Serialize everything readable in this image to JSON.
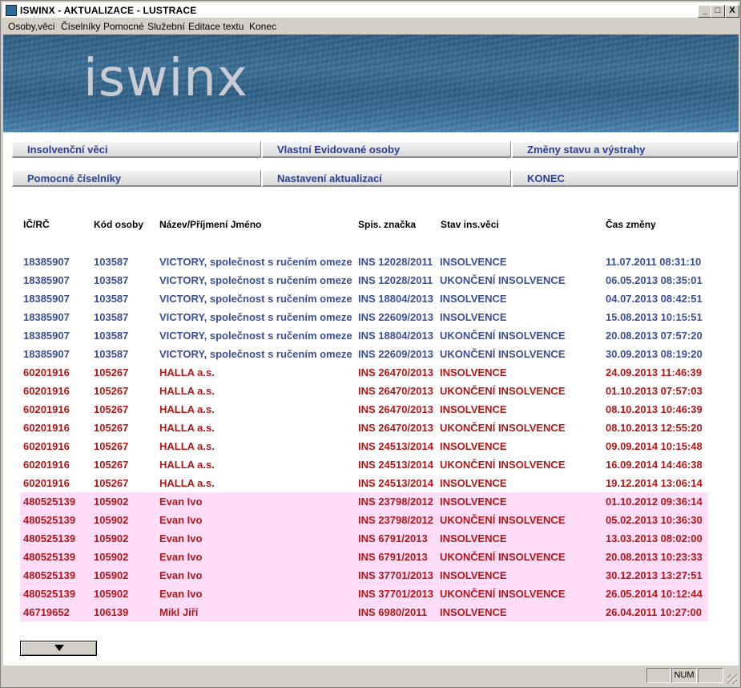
{
  "window": {
    "title": "ISWINX - AKTUALIZACE - LUSTRACE"
  },
  "window_buttons": {
    "minimize": "_",
    "maximize": "□",
    "close": "X"
  },
  "menu": [
    "Osoby,věci",
    "Číselníky",
    "Pomocné",
    "Služební",
    "Editace textu",
    "Konec"
  ],
  "banner": {
    "logo": "iswinx"
  },
  "nav": {
    "row1": [
      "Insolvenční věci",
      "Vlastní Evidované osoby",
      "Změny stavu a výstrahy"
    ],
    "row2": [
      "Pomocné číselníky",
      "Nastavení aktualizací",
      "KONEC"
    ]
  },
  "table": {
    "headers": [
      "IČ/RČ",
      "Kód osoby",
      "Název/Příjmení Jméno",
      "Spis. značka",
      "Stav ins.věci",
      "Čas změny"
    ],
    "rows": [
      {
        "ic": "18385907",
        "kod": "103587",
        "nazev": "VICTORY, společnost s ručením omezeným",
        "spis": "INS 12028/2011",
        "stav": "INSOLVENCE",
        "cas": "11.07.2011 08:31:10",
        "group": "blue"
      },
      {
        "ic": "18385907",
        "kod": "103587",
        "nazev": "VICTORY, společnost s ručením omezeným",
        "spis": "INS 12028/2011",
        "stav": "UKONČENÍ INSOLVENCE",
        "cas": "06.05.2013 08:35:01",
        "group": "blue"
      },
      {
        "ic": "18385907",
        "kod": "103587",
        "nazev": "VICTORY, společnost s ručením omezeným",
        "spis": "INS 18804/2013",
        "stav": "INSOLVENCE",
        "cas": "04.07.2013 08:42:51",
        "group": "blue"
      },
      {
        "ic": "18385907",
        "kod": "103587",
        "nazev": "VICTORY, společnost s ručením omezeným",
        "spis": "INS 22609/2013",
        "stav": "INSOLVENCE",
        "cas": "15.08.2013 10:15:51",
        "group": "blue"
      },
      {
        "ic": "18385907",
        "kod": "103587",
        "nazev": "VICTORY, společnost s ručením omezeným",
        "spis": "INS 18804/2013",
        "stav": "UKONČENÍ INSOLVENCE",
        "cas": "20.08.2013 07:57:20",
        "group": "blue"
      },
      {
        "ic": "18385907",
        "kod": "103587",
        "nazev": "VICTORY, společnost s ručením omezeným",
        "spis": "INS 22609/2013",
        "stav": "UKONČENÍ INSOLVENCE",
        "cas": "30.09.2013 08:19:20",
        "group": "blue"
      },
      {
        "ic": "60201916",
        "kod": "105267",
        "nazev": "HALLA a.s.",
        "spis": "INS 26470/2013",
        "stav": "INSOLVENCE",
        "cas": "24.09.2013 11:46:39",
        "group": "red"
      },
      {
        "ic": "60201916",
        "kod": "105267",
        "nazev": "HALLA a.s.",
        "spis": "INS 26470/2013",
        "stav": "UKONČENÍ INSOLVENCE",
        "cas": "01.10.2013 07:57:03",
        "group": "red"
      },
      {
        "ic": "60201916",
        "kod": "105267",
        "nazev": "HALLA a.s.",
        "spis": "INS 26470/2013",
        "stav": "INSOLVENCE",
        "cas": "08.10.2013 10:46:39",
        "group": "red"
      },
      {
        "ic": "60201916",
        "kod": "105267",
        "nazev": "HALLA a.s.",
        "spis": "INS 26470/2013",
        "stav": "UKONČENÍ INSOLVENCE",
        "cas": "08.10.2013 12:55:20",
        "group": "red"
      },
      {
        "ic": "60201916",
        "kod": "105267",
        "nazev": "HALLA a.s.",
        "spis": "INS 24513/2014",
        "stav": "INSOLVENCE",
        "cas": "09.09.2014 10:15:48",
        "group": "red"
      },
      {
        "ic": "60201916",
        "kod": "105267",
        "nazev": "HALLA a.s.",
        "spis": "INS 24513/2014",
        "stav": "UKONČENÍ INSOLVENCE",
        "cas": "16.09.2014 14:46:38",
        "group": "red"
      },
      {
        "ic": "60201916",
        "kod": "105267",
        "nazev": "HALLA a.s.",
        "spis": "INS 24513/2014",
        "stav": "INSOLVENCE",
        "cas": "19.12.2014 13:06:14",
        "group": "red"
      },
      {
        "ic": "480525139",
        "kod": "105902",
        "nazev": "Evan Ivo",
        "spis": "INS 23798/2012",
        "stav": "INSOLVENCE",
        "cas": "01.10.2012 09:36:14",
        "group": "pink"
      },
      {
        "ic": "480525139",
        "kod": "105902",
        "nazev": "Evan Ivo",
        "spis": "INS 23798/2012",
        "stav": "UKONČENÍ INSOLVENCE",
        "cas": "05.02.2013 10:36:30",
        "group": "pink"
      },
      {
        "ic": "480525139",
        "kod": "105902",
        "nazev": "Evan Ivo",
        "spis": "INS 6791/2013",
        "stav": "INSOLVENCE",
        "cas": "13.03.2013 08:02:00",
        "group": "pink"
      },
      {
        "ic": "480525139",
        "kod": "105902",
        "nazev": "Evan Ivo",
        "spis": "INS 6791/2013",
        "stav": "UKONČENÍ INSOLVENCE",
        "cas": "20.08.2013 10:23:33",
        "group": "pink"
      },
      {
        "ic": "480525139",
        "kod": "105902",
        "nazev": "Evan Ivo",
        "spis": "INS 37701/2013",
        "stav": "INSOLVENCE",
        "cas": "30.12.2013 13:27:51",
        "group": "pink"
      },
      {
        "ic": "480525139",
        "kod": "105902",
        "nazev": "Evan Ivo",
        "spis": "INS 37701/2013",
        "stav": "UKONČENÍ INSOLVENCE",
        "cas": "26.05.2014 10:12:44",
        "group": "pink"
      },
      {
        "ic": "46719652",
        "kod": "106139",
        "nazev": "Mikl Jiří",
        "spis": "INS 6980/2011",
        "stav": "INSOLVENCE",
        "cas": "26.04.2011 10:27:00",
        "group": "pink"
      }
    ]
  },
  "status": {
    "num": "NUM"
  },
  "colors": {
    "blue_text": "#3a4f96",
    "red_text": "#b01818",
    "pink_bg": "#ffdcf8",
    "nav_text": "#2b3f8f"
  }
}
